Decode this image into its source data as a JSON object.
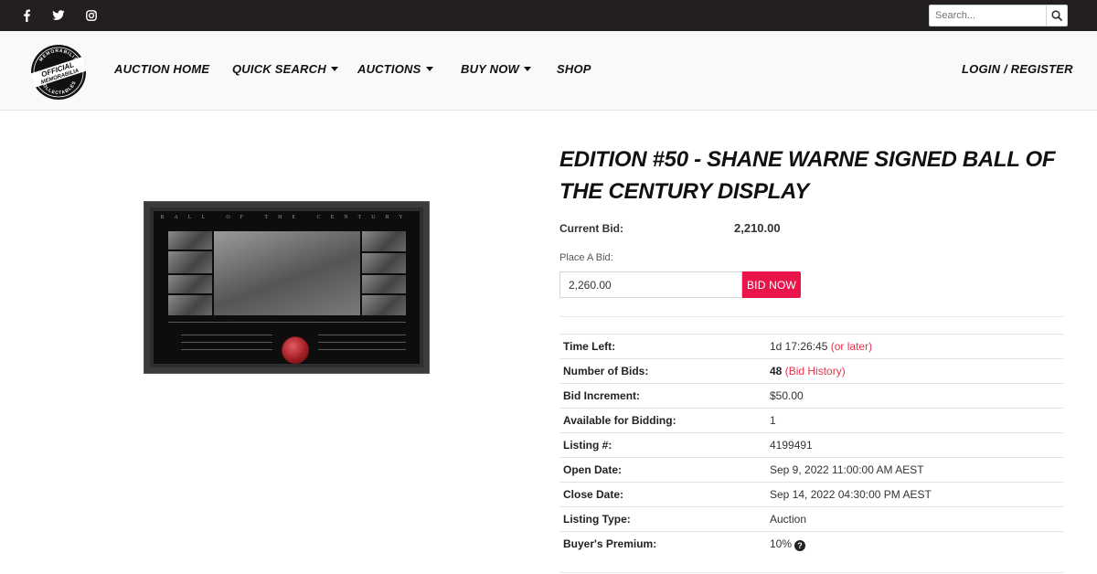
{
  "topbar": {
    "social": [
      {
        "name": "facebook-icon"
      },
      {
        "name": "twitter-icon"
      },
      {
        "name": "instagram-icon"
      }
    ],
    "search": {
      "placeholder": "Search..."
    }
  },
  "nav": {
    "logo": {
      "line1": "OFFICIAL",
      "line2": "MEMORABILIA",
      "top_arc": "MEMORABILIA",
      "bottom_arc": "COLLECTABLES"
    },
    "items": [
      {
        "label": "AUCTION HOME",
        "dropdown": false
      },
      {
        "label": "QUICK SEARCH",
        "dropdown": true
      },
      {
        "label": "AUCTIONS",
        "dropdown": true
      },
      {
        "label": "BUY NOW",
        "dropdown": true
      },
      {
        "label": "SHOP",
        "dropdown": false
      }
    ],
    "login_label": "LOGIN / REGISTER"
  },
  "product": {
    "image_title": "BALL OF THE CENTURY",
    "title": "EDITION #50 - SHANE WARNE SIGNED BALL OF THE CENTURY DISPLAY",
    "current_bid_label": "Current Bid:",
    "current_bid_value": "2,210.00",
    "place_bid_label": "Place A Bid:",
    "bid_input_value": "2,260.00",
    "bid_button_label": "BID NOW"
  },
  "details": {
    "time_left": {
      "label": "Time Left:",
      "value": "1d 17:26:45",
      "link": "(or later)"
    },
    "num_bids": {
      "label": "Number of Bids:",
      "value": "48",
      "link": "(Bid History)"
    },
    "bid_increment": {
      "label": "Bid Increment:",
      "value": "$50.00"
    },
    "available": {
      "label": "Available for Bidding:",
      "value": "1"
    },
    "listing": {
      "label": "Listing #:",
      "value": "4199491"
    },
    "open_date": {
      "label": "Open Date:",
      "value": "Sep 9, 2022 11:00:00 AM AEST"
    },
    "close_date": {
      "label": "Close Date:",
      "value": "Sep 14, 2022 04:30:00 PM AEST"
    },
    "listing_type": {
      "label": "Listing Type:",
      "value": "Auction"
    },
    "buyers_premium": {
      "label": "Buyer's Premium:",
      "value": "10%",
      "help": "?"
    }
  },
  "colors": {
    "accent": "#e8144a",
    "link": "#e5344e",
    "topbar": "#231f20",
    "nav_bg": "#f8f9fa"
  }
}
